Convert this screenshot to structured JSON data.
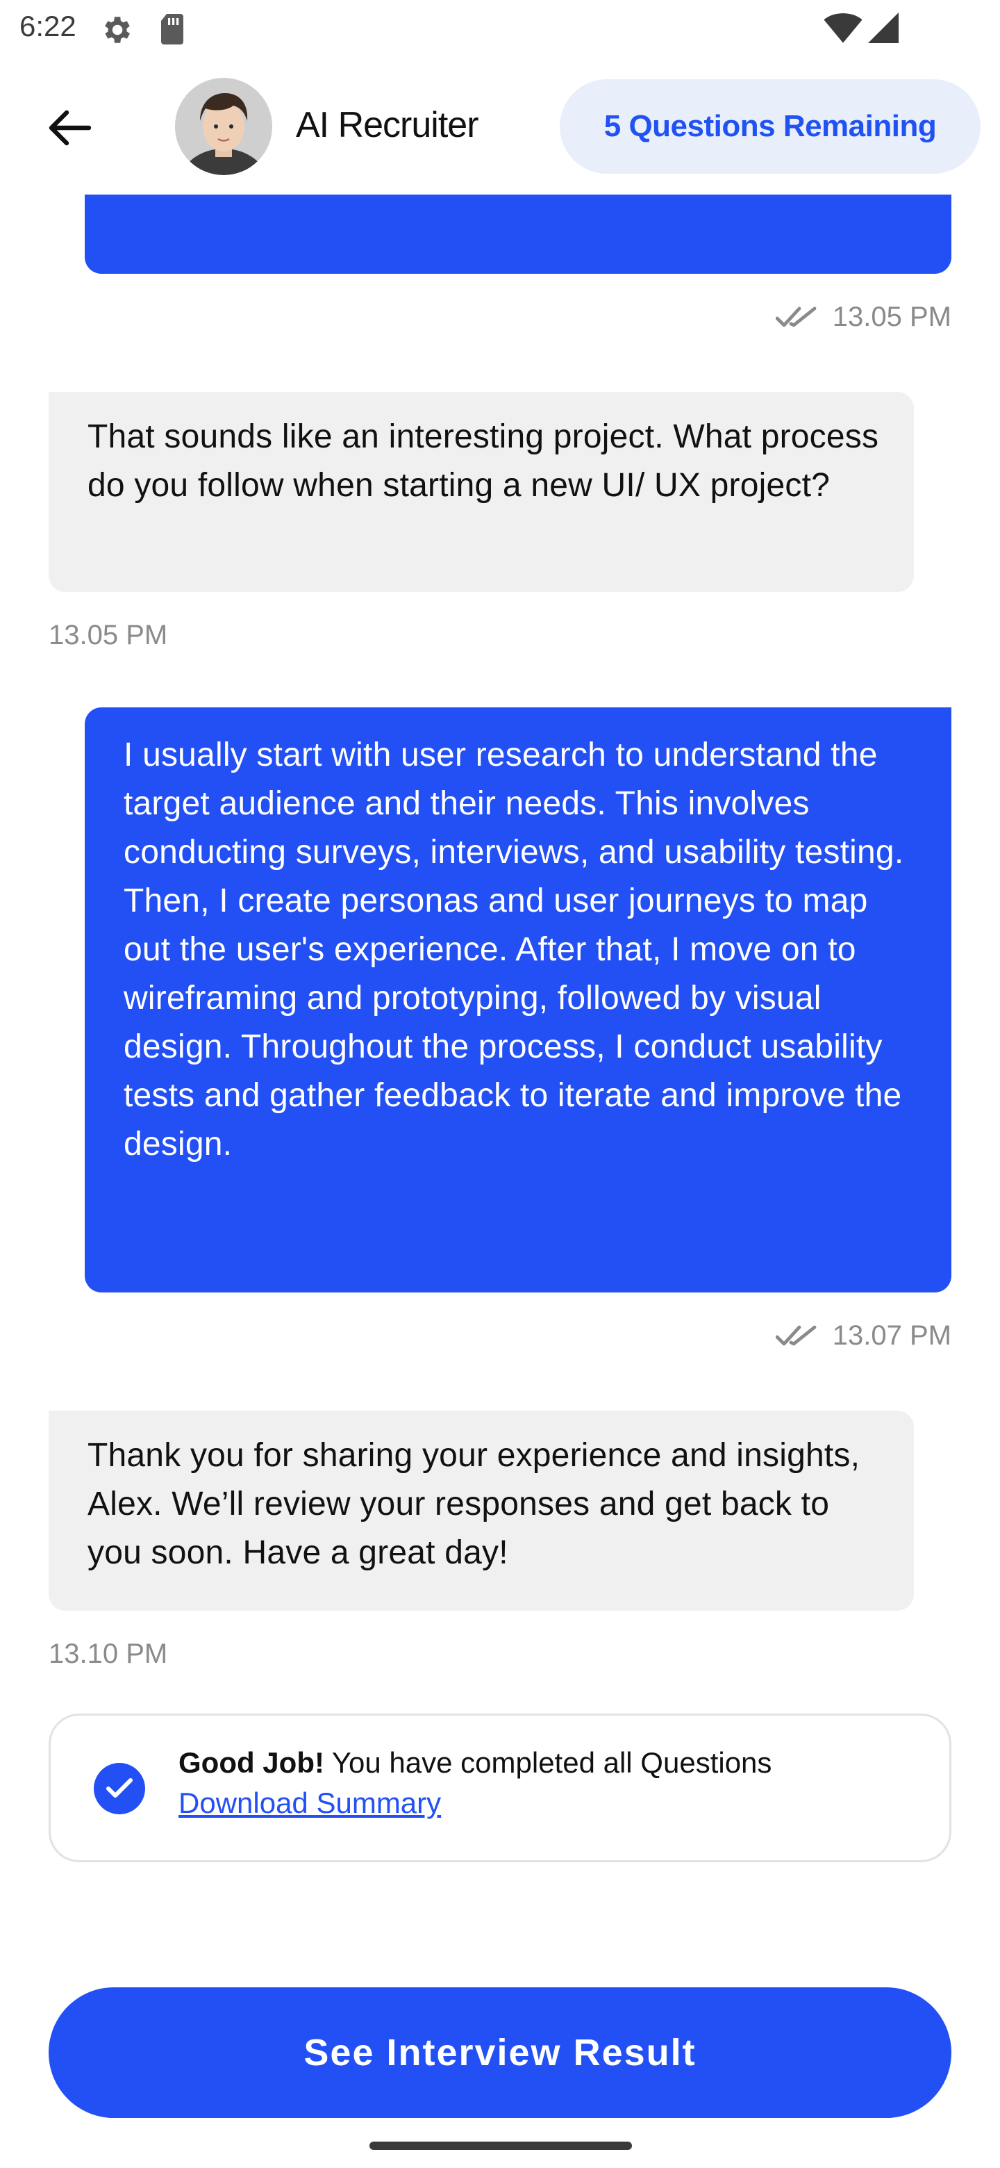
{
  "status_bar": {
    "time": "6:22",
    "icons": [
      "gear-icon",
      "sd-card-icon",
      "wifi-icon",
      "cell-signal-icon"
    ]
  },
  "header": {
    "back_icon": "arrow-left-icon",
    "title": "AI Recruiter",
    "remaining_label": "5 Questions Remaining"
  },
  "messages": [
    {
      "from": "user",
      "text": "",
      "time": "13.05 PM"
    },
    {
      "from": "bot",
      "text": "That sounds like an interesting project. What process do you follow when starting a new UI/ UX project?",
      "time": "13.05 PM"
    },
    {
      "from": "user",
      "text": "I usually start with user research to understand the target audience and their needs. This involves conducting surveys, interviews, and usability testing. Then, I create personas and user journeys to map out the user's experience. After that, I move on to wireframing and prototyping, followed by visual design. Throughout the process, I conduct usability tests and gather feedback to iterate and improve the design.",
      "time": "13.07 PM"
    },
    {
      "from": "bot",
      "text": "Thank you for sharing your experience and insights, Alex. We’ll review your responses and get back to you soon. Have a great day!",
      "time": "13.10 PM"
    }
  ],
  "completion": {
    "bold": "Good Job!",
    "text": " You have completed all Questions",
    "link": "Download Summary"
  },
  "cta": {
    "label": "See Interview Result"
  },
  "colors": {
    "primary": "#2250f5",
    "bot_bubble": "#f0f0f0",
    "pill_bg": "#e9eefb",
    "muted": "#8a8a8a"
  }
}
